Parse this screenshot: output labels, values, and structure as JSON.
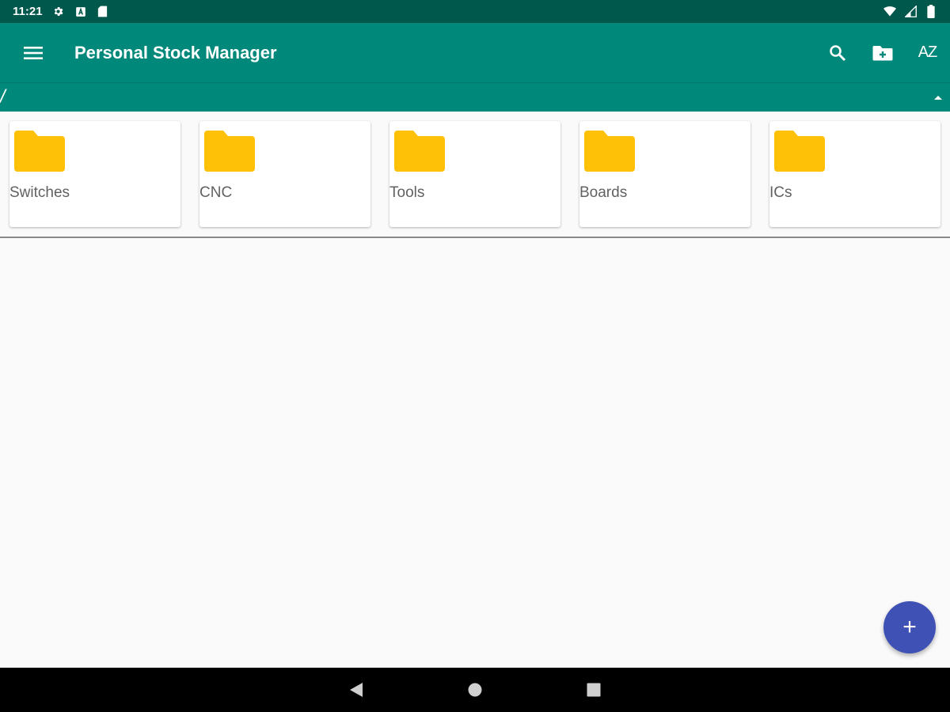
{
  "status_bar": {
    "time": "11:21",
    "icons_left": [
      "settings-icon",
      "a-box-icon",
      "sd-card-icon"
    ],
    "icons_right": [
      "wifi-icon",
      "signal-icon",
      "battery-icon"
    ]
  },
  "toolbar": {
    "title": "Personal Stock Manager",
    "menu_icon": "menu-icon",
    "actions": [
      "search-icon",
      "new-folder-icon",
      "sort-az-icon"
    ],
    "sort_label": "AZ"
  },
  "path_bar": {
    "path": "/",
    "collapse_icon": "arrow-up-icon"
  },
  "folders": [
    {
      "name": "Switches"
    },
    {
      "name": "CNC"
    },
    {
      "name": "Tools"
    },
    {
      "name": "Boards"
    },
    {
      "name": "ICs"
    }
  ],
  "fab": {
    "label": "+"
  },
  "nav_bar": {
    "buttons": [
      "back-icon",
      "home-icon",
      "recents-icon"
    ]
  },
  "colors": {
    "status_bar": "#00574b",
    "primary": "#00897b",
    "folder": "#ffc107",
    "fab": "#3f51b5",
    "background": "#fafafa"
  }
}
